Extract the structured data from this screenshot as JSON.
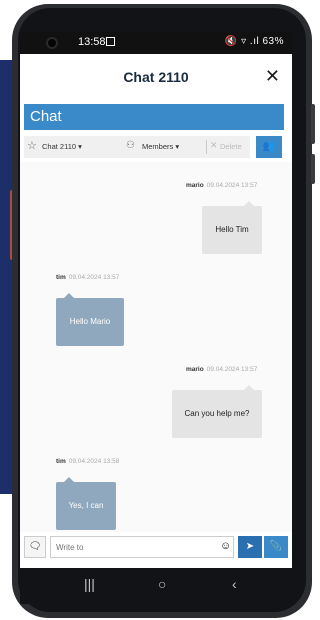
{
  "status": {
    "time": "13:58",
    "icons_right": "🔇 ▿ .ıl 63%"
  },
  "header": {
    "title": "Chat 2110",
    "close_label": "✕"
  },
  "section_title": "Chat",
  "toolbar": {
    "chat_selector": "Chat 2110 ▾",
    "members": "Members ▾",
    "delete": "Delete"
  },
  "messages": [
    {
      "sender": "mario",
      "time": "09.04.2024 13:57",
      "text": "Hello Tim",
      "direction": "out"
    },
    {
      "sender": "tim",
      "time": "09.04.2024 13:57",
      "text": "Hello Mario",
      "direction": "in"
    },
    {
      "sender": "mario",
      "time": "09.04.2024 13:57",
      "text": "Can you help me?",
      "direction": "out"
    },
    {
      "sender": "tim",
      "time": "09.04.2024 13:58",
      "text": "Yes, I can",
      "direction": "in"
    }
  ],
  "input": {
    "placeholder": "Write to"
  },
  "colors": {
    "accent": "#3a89c9",
    "incoming_bubble": "#8fa8bd",
    "outgoing_bubble": "#e4e4e4"
  },
  "navbar": {
    "recent": "|||",
    "home": "○",
    "back": "‹"
  }
}
